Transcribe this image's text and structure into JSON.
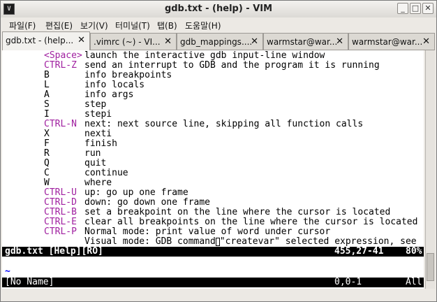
{
  "window": {
    "title": "gdb.txt - (help) - VIM",
    "icon_glyph": "V"
  },
  "menu": [
    {
      "label": "파일(F)"
    },
    {
      "label": "편집(E)"
    },
    {
      "label": "보기(V)"
    },
    {
      "label": "터미널(T)"
    },
    {
      "label": "탭(B)"
    },
    {
      "label": "도움말(H)"
    }
  ],
  "tabs": [
    {
      "label": "gdb.txt - (help...",
      "close": "✕"
    },
    {
      "label": ".vimrc (~) - VI...",
      "close": "✕"
    },
    {
      "label": "gdb_mappings....",
      "close": "✕"
    },
    {
      "label": "warmstar@war...",
      "close": "✕"
    },
    {
      "label": "warmstar@war...",
      "close": "✕"
    }
  ],
  "help_lines": [
    {
      "key": "<Space>",
      "ctrl": true,
      "desc": "launch the interactive gdb input-line window"
    },
    {
      "key": "CTRL-Z",
      "ctrl": true,
      "desc": "send an interrupt to GDB and the program it is running"
    },
    {
      "key": "B",
      "ctrl": false,
      "desc": "info breakpoints"
    },
    {
      "key": "L",
      "ctrl": false,
      "desc": "info locals"
    },
    {
      "key": "A",
      "ctrl": false,
      "desc": "info args"
    },
    {
      "key": "S",
      "ctrl": false,
      "desc": "step"
    },
    {
      "key": "I",
      "ctrl": false,
      "desc": "stepi"
    },
    {
      "key": "CTRL-N",
      "ctrl": true,
      "desc": "next: next source line, skipping all function calls"
    },
    {
      "key": "X",
      "ctrl": false,
      "desc": "nexti"
    },
    {
      "key": "F",
      "ctrl": false,
      "desc": "finish"
    },
    {
      "key": "R",
      "ctrl": false,
      "desc": "run"
    },
    {
      "key": "Q",
      "ctrl": false,
      "desc": "quit"
    },
    {
      "key": "C",
      "ctrl": false,
      "desc": "continue"
    },
    {
      "key": "W",
      "ctrl": false,
      "desc": "where"
    },
    {
      "key": "CTRL-U",
      "ctrl": true,
      "desc": "up: go up one frame"
    },
    {
      "key": "CTRL-D",
      "ctrl": true,
      "desc": "down: go down one frame"
    },
    {
      "key": "CTRL-B",
      "ctrl": true,
      "desc": "set a breakpoint on the line where the cursor is located"
    },
    {
      "key": "CTRL-E",
      "ctrl": true,
      "desc": "clear all breakpoints on the line where the cursor is located"
    },
    {
      "key": "CTRL-P",
      "ctrl": true,
      "desc": "Normal mode: print value of word under cursor"
    },
    {
      "key": "",
      "ctrl": false,
      "desc": "Visual mode: GDB command",
      "after_cursor": "\"createvar\" selected expression, see"
    }
  ],
  "status_help": {
    "left": "gdb.txt [Help][RO]",
    "pos": "455,27-41",
    "pct": "80%"
  },
  "empty_line": "~",
  "status_noname": {
    "left": "[No Name]",
    "pos": "0,0-1",
    "pct": "All"
  }
}
